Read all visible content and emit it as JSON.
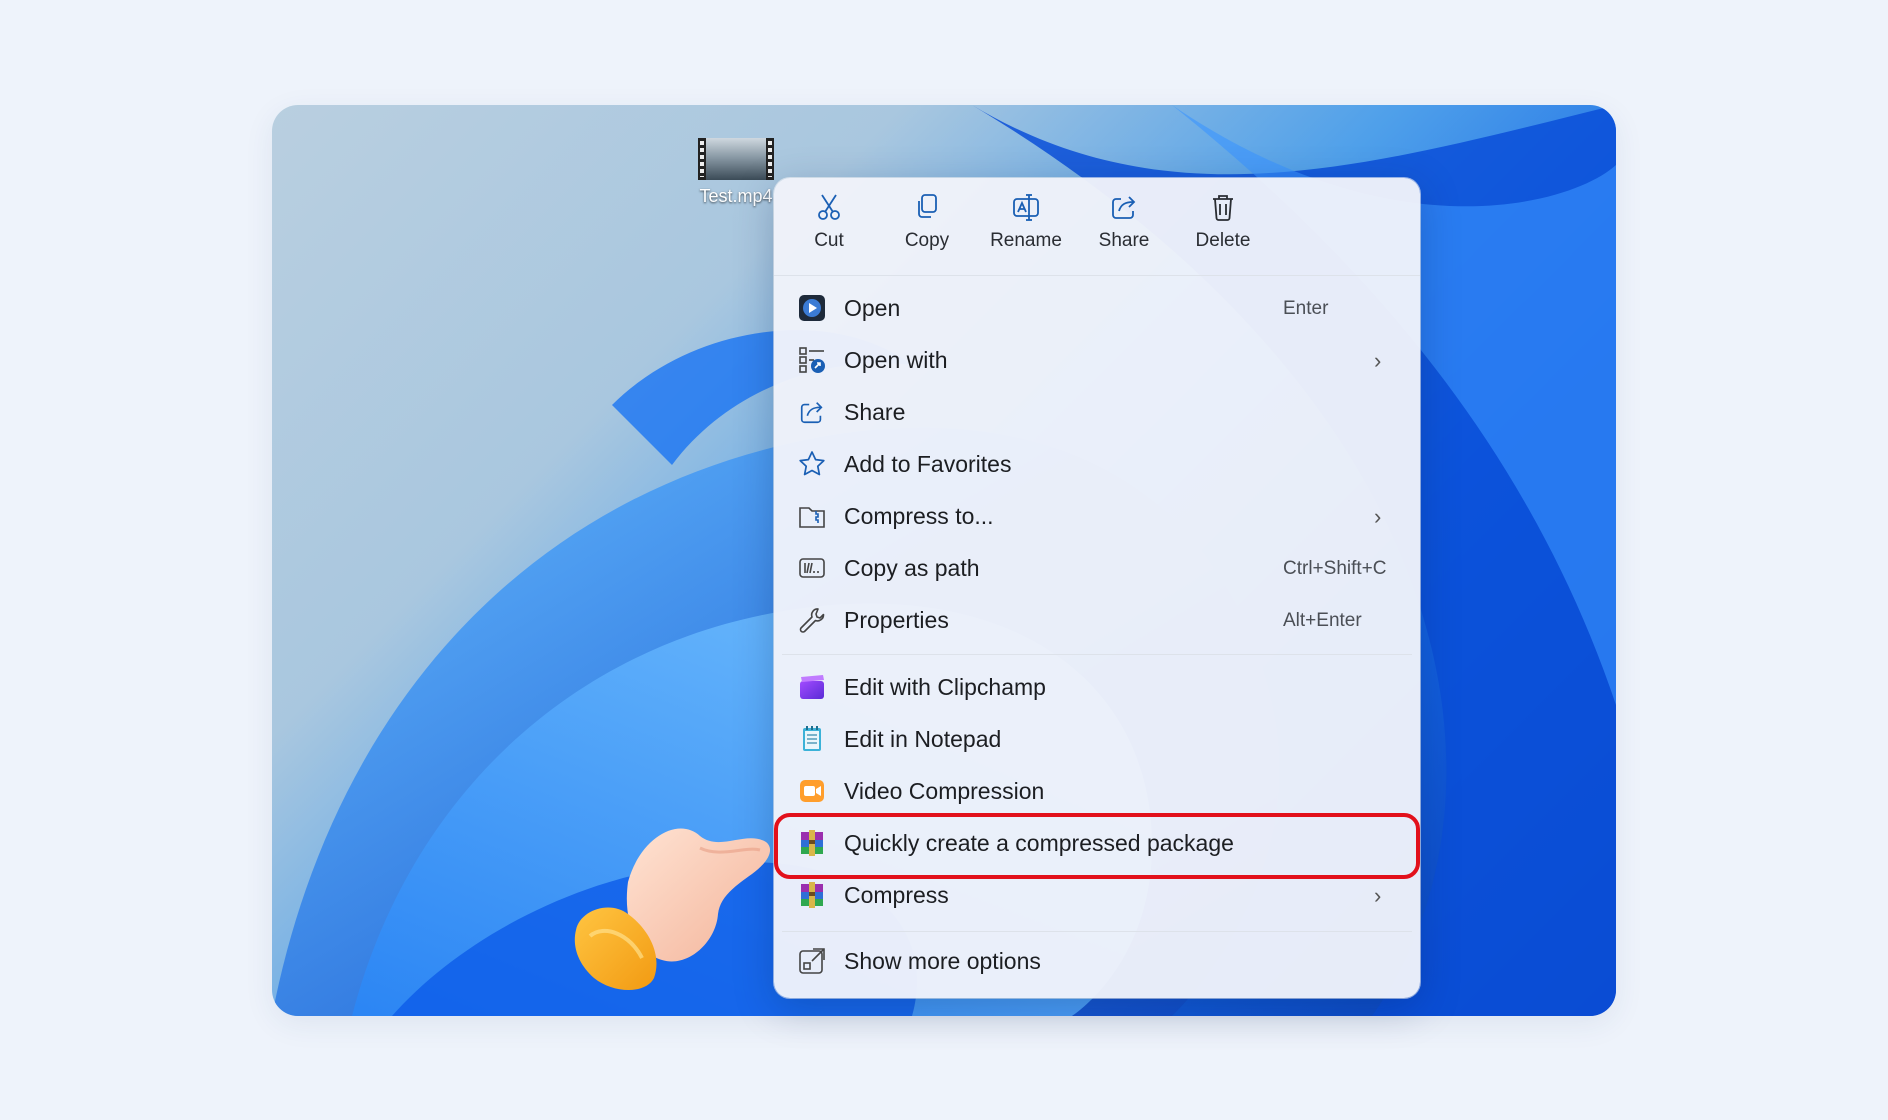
{
  "desktop": {
    "file": {
      "name": "Test.mp4"
    }
  },
  "context_menu": {
    "toolbar": [
      {
        "label": "Cut",
        "icon": "scissors-icon"
      },
      {
        "label": "Copy",
        "icon": "copy-icon"
      },
      {
        "label": "Rename",
        "icon": "rename-icon"
      },
      {
        "label": "Share",
        "icon": "share-icon"
      },
      {
        "label": "Delete",
        "icon": "trash-icon"
      }
    ],
    "items": [
      {
        "label": "Open",
        "shortcut": "Enter",
        "icon": "play-icon"
      },
      {
        "label": "Open with",
        "icon": "open-with-icon",
        "submenu": true
      },
      {
        "label": "Share",
        "icon": "share-icon"
      },
      {
        "label": "Add to Favorites",
        "icon": "star-icon"
      },
      {
        "label": "Compress to...",
        "icon": "zip-folder-icon",
        "submenu": true
      },
      {
        "label": "Copy as path",
        "shortcut": "Ctrl+Shift+C",
        "icon": "path-icon"
      },
      {
        "label": "Properties",
        "shortcut": "Alt+Enter",
        "icon": "wrench-icon"
      },
      {
        "label": "Edit with Clipchamp",
        "icon": "clipchamp-icon"
      },
      {
        "label": "Edit in Notepad",
        "icon": "notepad-icon"
      },
      {
        "label": "Video Compression",
        "icon": "video-compression-icon"
      },
      {
        "label": "Quickly create a compressed package",
        "icon": "winrar-icon",
        "highlighted": true
      },
      {
        "label": "Compress",
        "icon": "winrar-icon",
        "submenu": true
      },
      {
        "label": "Show more options",
        "icon": "more-options-icon"
      }
    ],
    "chevron": "›"
  },
  "colors": {
    "highlight_border": "#e2101b",
    "icon_blue": "#1a5fb4",
    "menu_bg": "#f0f3fa"
  }
}
